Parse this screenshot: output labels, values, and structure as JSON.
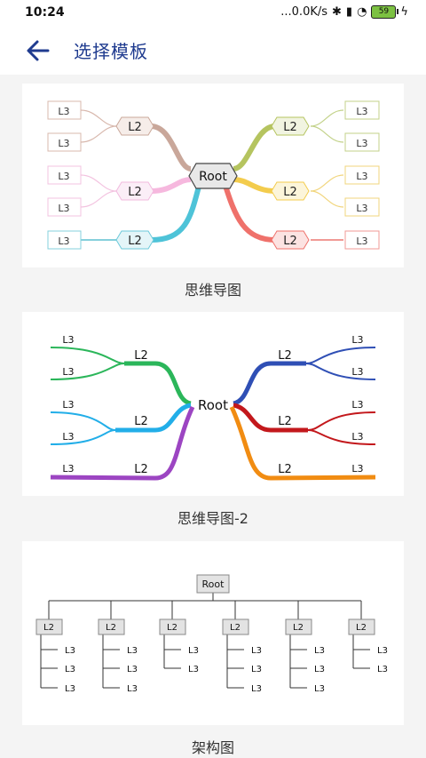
{
  "status": {
    "time": "10:24",
    "net_speed": "...0.0K/s",
    "battery": "59"
  },
  "appbar": {
    "title": "选择模板"
  },
  "templates": [
    {
      "caption": "思维导图",
      "root": "Root",
      "l2": "L2",
      "l3": "L3"
    },
    {
      "caption": "思维导图-2",
      "root": "Root",
      "l2": "L2",
      "l3": "L3"
    },
    {
      "caption": "架构图",
      "root": "Root",
      "l2": "L2",
      "l3": "L3"
    }
  ]
}
